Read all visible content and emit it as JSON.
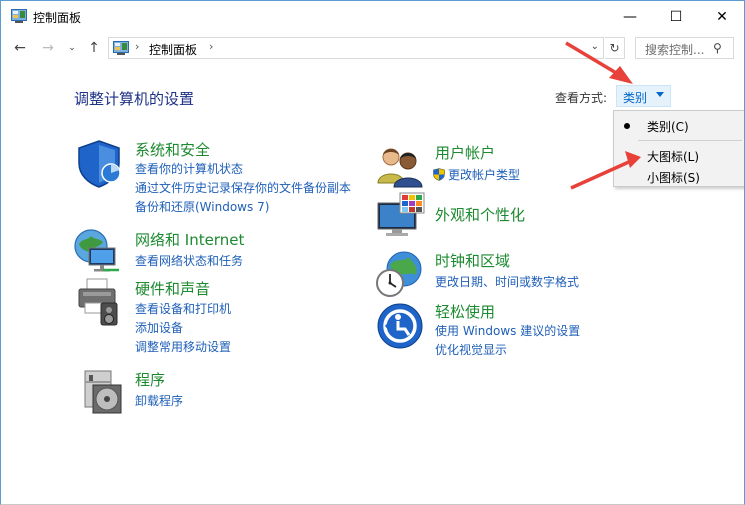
{
  "window": {
    "title": "控制面板",
    "min_glyph": "—",
    "max_glyph": "☐",
    "close_glyph": "✕"
  },
  "nav": {
    "back_glyph": "←",
    "forward_glyph": "→",
    "recent_glyph": "⌄",
    "up_glyph": "↑",
    "sep_glyph": "›",
    "breadcrumb": "控制面板",
    "addr_drop_glyph": "⌄",
    "refresh_glyph": "↻",
    "search_placeholder": "搜索控制...",
    "search_glyph": "⚲"
  },
  "header": {
    "page_title": "调整计算机的设置",
    "view_by_label": "查看方式:",
    "view_by_value": "类别"
  },
  "view_menu": {
    "items": [
      {
        "label": "类别(C)",
        "selected": true
      },
      {
        "label": "大图标(L)",
        "selected": false
      },
      {
        "label": "小图标(S)",
        "selected": false
      }
    ]
  },
  "categories": {
    "system": {
      "title": "系统和安全",
      "links": [
        "查看你的计算机状态",
        "通过文件历史记录保存你的文件备份副本",
        "备份和还原(Windows 7)"
      ]
    },
    "network": {
      "title": "网络和 Internet",
      "links": [
        "查看网络状态和任务"
      ]
    },
    "hardware": {
      "title": "硬件和声音",
      "links": [
        "查看设备和打印机",
        "添加设备",
        "调整常用移动设置"
      ]
    },
    "programs": {
      "title": "程序",
      "links": [
        "卸载程序"
      ]
    },
    "users": {
      "title": "用户帐户",
      "links": [
        "更改帐户类型"
      ]
    },
    "appearance": {
      "title": "外观和个性化",
      "links": []
    },
    "clock": {
      "title": "时钟和区域",
      "links": [
        "更改日期、时间或数字格式"
      ]
    },
    "ease": {
      "title": "轻松使用",
      "links": [
        "使用 Windows 建议的设置",
        "优化视觉显示"
      ]
    }
  },
  "colors": {
    "category_title": "#1c8a2f",
    "link": "#1f5fb8",
    "page_title": "#1e3287",
    "annotation_arrow": "#e8413a"
  },
  "icons": [
    "control-panel-icon",
    "shield-icon",
    "network-globe-icon",
    "printer-icon",
    "programs-disc-icon",
    "users-icon",
    "uac-shield-icon",
    "monitor-palette-icon",
    "clock-globe-icon",
    "ease-of-access-icon"
  ]
}
